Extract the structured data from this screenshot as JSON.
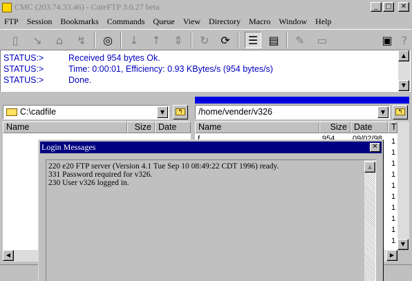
{
  "window": {
    "title": "CMC (203.74.33.46) - CuteFTP 3.0.27 beta",
    "controls": {
      "minimize": "_",
      "maximize": "□",
      "close": "✕"
    }
  },
  "menu": [
    "FTP",
    "Session",
    "Bookmarks",
    "Commands",
    "Queue",
    "View",
    "Directory",
    "Macro",
    "Window",
    "Help"
  ],
  "toolbar": {
    "icons": [
      "connect-book-icon",
      "disconnect-icon",
      "quick-connect-icon",
      "reconnect-icon",
      "stop-icon",
      "download-icon",
      "upload-icon",
      "transfer-icon",
      "refresh-icon",
      "reload-icon",
      "list-view-icon",
      "detail-view-icon",
      "edit-icon",
      "preview-icon",
      "queue-icon",
      "help-icon"
    ]
  },
  "status_log": [
    {
      "label": "STATUS:>",
      "message": "Received 954 bytes Ok."
    },
    {
      "label": "STATUS:>",
      "message": "Time: 0:00:01, Efficiency: 0.93 KBytes/s (954 bytes/s)"
    },
    {
      "label": "STATUS:>",
      "message": "Done."
    }
  ],
  "local_pane": {
    "path": "C:\\cadfile",
    "columns": [
      "Name",
      "Size",
      "Date"
    ]
  },
  "remote_pane": {
    "path": "/home/vender/v326",
    "columns": [
      "Name",
      "Size",
      "Date",
      "T"
    ],
    "partial_row": {
      "name": "f",
      "size": "954",
      "date": "09/02/98"
    },
    "right_column_values": [
      "1",
      "1",
      "1",
      "1",
      "1",
      "1",
      "1",
      "1",
      "1",
      "1"
    ]
  },
  "dialog": {
    "title": "Login Messages",
    "close": "✕",
    "lines": [
      "220 e20 FTP server (Version 4.1 Tue Sep 10 08:49:22 CDT 1996) ready.",
      "331 Password required for v326.",
      "230 User v326 logged in."
    ]
  },
  "colors": {
    "status_text": "#0000c0",
    "dialog_title_bg": "#000080",
    "active_title_strip": "#0000e0"
  }
}
